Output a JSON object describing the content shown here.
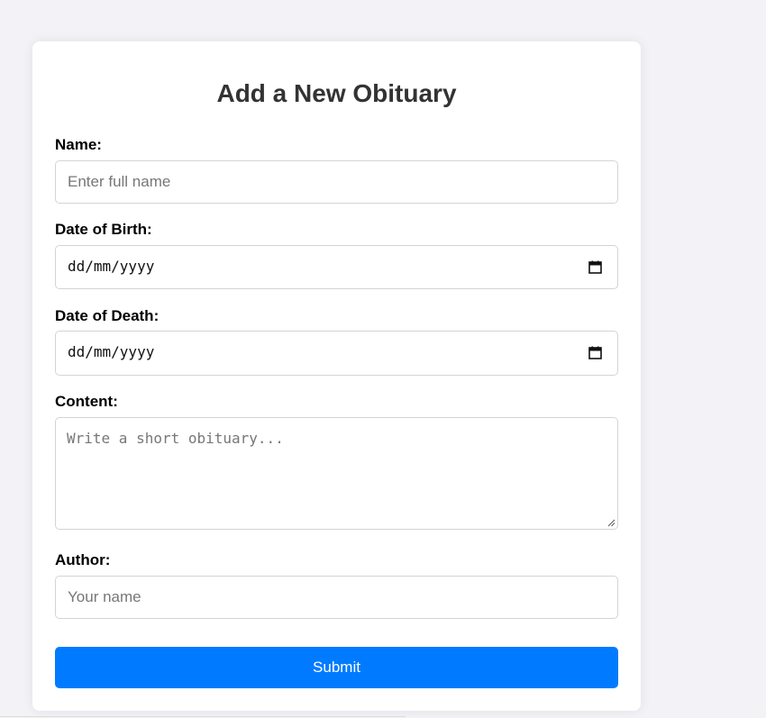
{
  "form": {
    "title": "Add a New Obituary",
    "name_label": "Name:",
    "name_placeholder": "Enter full name",
    "dob_label": "Date of Birth:",
    "dob_placeholder": "dd/mm/yyyy",
    "dod_label": "Date of Death:",
    "dod_placeholder": "dd/mm/yyyy",
    "content_label": "Content:",
    "content_placeholder": "Write a short obituary...",
    "author_label": "Author:",
    "author_placeholder": "Your name",
    "submit_label": "Submit"
  },
  "icons": {
    "date_picker": "calendar-icon",
    "resize": "resize-handle-icon"
  },
  "colors": {
    "page_background": "#f3f3f7",
    "card_background": "#ffffff",
    "title": "#333333",
    "button": "#007bff",
    "button_text": "#ffffff"
  }
}
